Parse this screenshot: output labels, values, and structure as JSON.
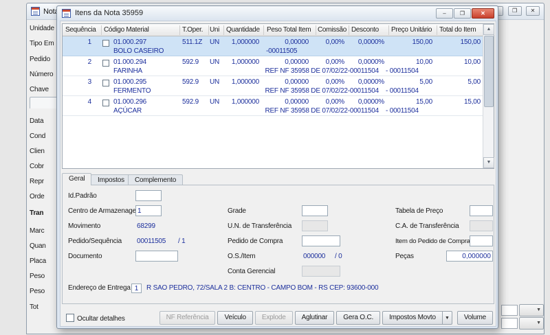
{
  "colors": {
    "navy": "#1c2f9c",
    "selection": "#cfe3f6",
    "close_red": "#c8402c"
  },
  "icons": {
    "minimize": "–",
    "restore": "❐",
    "close": "✕",
    "dropdown": "▼",
    "scroll_up": "▲",
    "scroll_down": "▼"
  },
  "background_window": {
    "title_fragment": "Nota",
    "left_labels": [
      "Unidade",
      "Tipo Em",
      "Pedido",
      "Número",
      "Chave",
      "Data",
      "Cond",
      "Clien",
      "Cobr",
      "Repr",
      "Orde",
      "Tran",
      "Marc",
      "Quan",
      "Placa",
      "Peso",
      "Peso",
      "Tot"
    ]
  },
  "dialog": {
    "title": "Itens da Nota 35959",
    "grid": {
      "columns": [
        "Sequência",
        "Código Material",
        "T.Oper.",
        "Uni",
        "Quantidade",
        "Peso Total Item",
        "Comissão",
        "Desconto",
        "Preço Unitário",
        "Total do Item"
      ],
      "rows": [
        {
          "seq": "1",
          "code": "01.000.297",
          "toper": "511.1Z",
          "uni": "UN",
          "qty": "1,000000",
          "peso": "0,00000",
          "comissao": "0,00%",
          "desconto": "0,0000%",
          "preco": "150,00",
          "total": "150,00",
          "desc": "BOLO CASEIRO",
          "ref": "-00011505",
          "ref2": ""
        },
        {
          "seq": "2",
          "code": "01.000.294",
          "toper": "592.9",
          "uni": "UN",
          "qty": "1,000000",
          "peso": "0,00000",
          "comissao": "0,00%",
          "desconto": "0,0000%",
          "preco": "10,00",
          "total": "10,00",
          "desc": "FARINHA",
          "ref": "REF NF 35958 DE 07/02/22-00011504",
          "ref2": "- 00011504"
        },
        {
          "seq": "3",
          "code": "01.000.295",
          "toper": "592.9",
          "uni": "UN",
          "qty": "1,000000",
          "peso": "0,00000",
          "comissao": "0,00%",
          "desconto": "0,0000%",
          "preco": "5,00",
          "total": "5,00",
          "desc": "FERMENTO",
          "ref": "REF NF 35958 DE 07/02/22-00011504",
          "ref2": "- 00011504"
        },
        {
          "seq": "4",
          "code": "01.000.296",
          "toper": "592.9",
          "uni": "UN",
          "qty": "1,000000",
          "peso": "0,00000",
          "comissao": "0,00%",
          "desconto": "0,0000%",
          "preco": "15,00",
          "total": "15,00",
          "desc": "AÇÚCAR",
          "ref": "REF NF 35958 DE 07/02/22-00011504",
          "ref2": "- 00011504"
        }
      ]
    },
    "tabs": [
      {
        "label": "Geral"
      },
      {
        "label": "Impostos"
      },
      {
        "label": "Complemento"
      }
    ],
    "form": {
      "id_padrao": {
        "label": "Id.Padrão"
      },
      "centro_armazenagem": {
        "label": "Centro de Armazenagem",
        "value": "1"
      },
      "movimento": {
        "label": "Movimento",
        "value": "68299"
      },
      "pedido_sequencia": {
        "label": "Pedido/Sequência",
        "value": "00011505",
        "value2": "/ 1"
      },
      "documento": {
        "label": "Documento"
      },
      "grade": {
        "label": "Grade"
      },
      "un_transferencia": {
        "label": "U.N. de Transferência"
      },
      "pedido_compra": {
        "label": "Pedido de Compra"
      },
      "os_item": {
        "label": "O.S./Item",
        "value": "000000",
        "value2": "/ 0"
      },
      "conta_gerencial": {
        "label": "Conta Gerencial"
      },
      "tabela_preco": {
        "label": "Tabela de Preço"
      },
      "ca_transferencia": {
        "label": "C.A. de Transferência"
      },
      "item_pedido_compra": {
        "label": "Item do Pedido de Compra"
      },
      "pecas": {
        "label": "Peças",
        "value": "0,000000"
      },
      "endereco_entrega": {
        "label": "Endereço de Entrega",
        "numero": "1",
        "value": "R SAO PEDRO, 72/SALA 2 B: CENTRO - CAMPO BOM - RS CEP: 93600-000"
      }
    },
    "footer": {
      "hide_details_label": "Ocultar detalhes",
      "buttons": [
        {
          "label": "NF Referência",
          "disabled": true
        },
        {
          "label": "Veículo",
          "disabled": false
        },
        {
          "label": "Explode",
          "disabled": true
        },
        {
          "label": "Aglutinar",
          "disabled": false
        },
        {
          "label": "Gera O.C.",
          "disabled": false
        },
        {
          "label": "Impostos Movto",
          "disabled": false
        },
        {
          "label": "Volume",
          "disabled": false
        }
      ]
    }
  }
}
